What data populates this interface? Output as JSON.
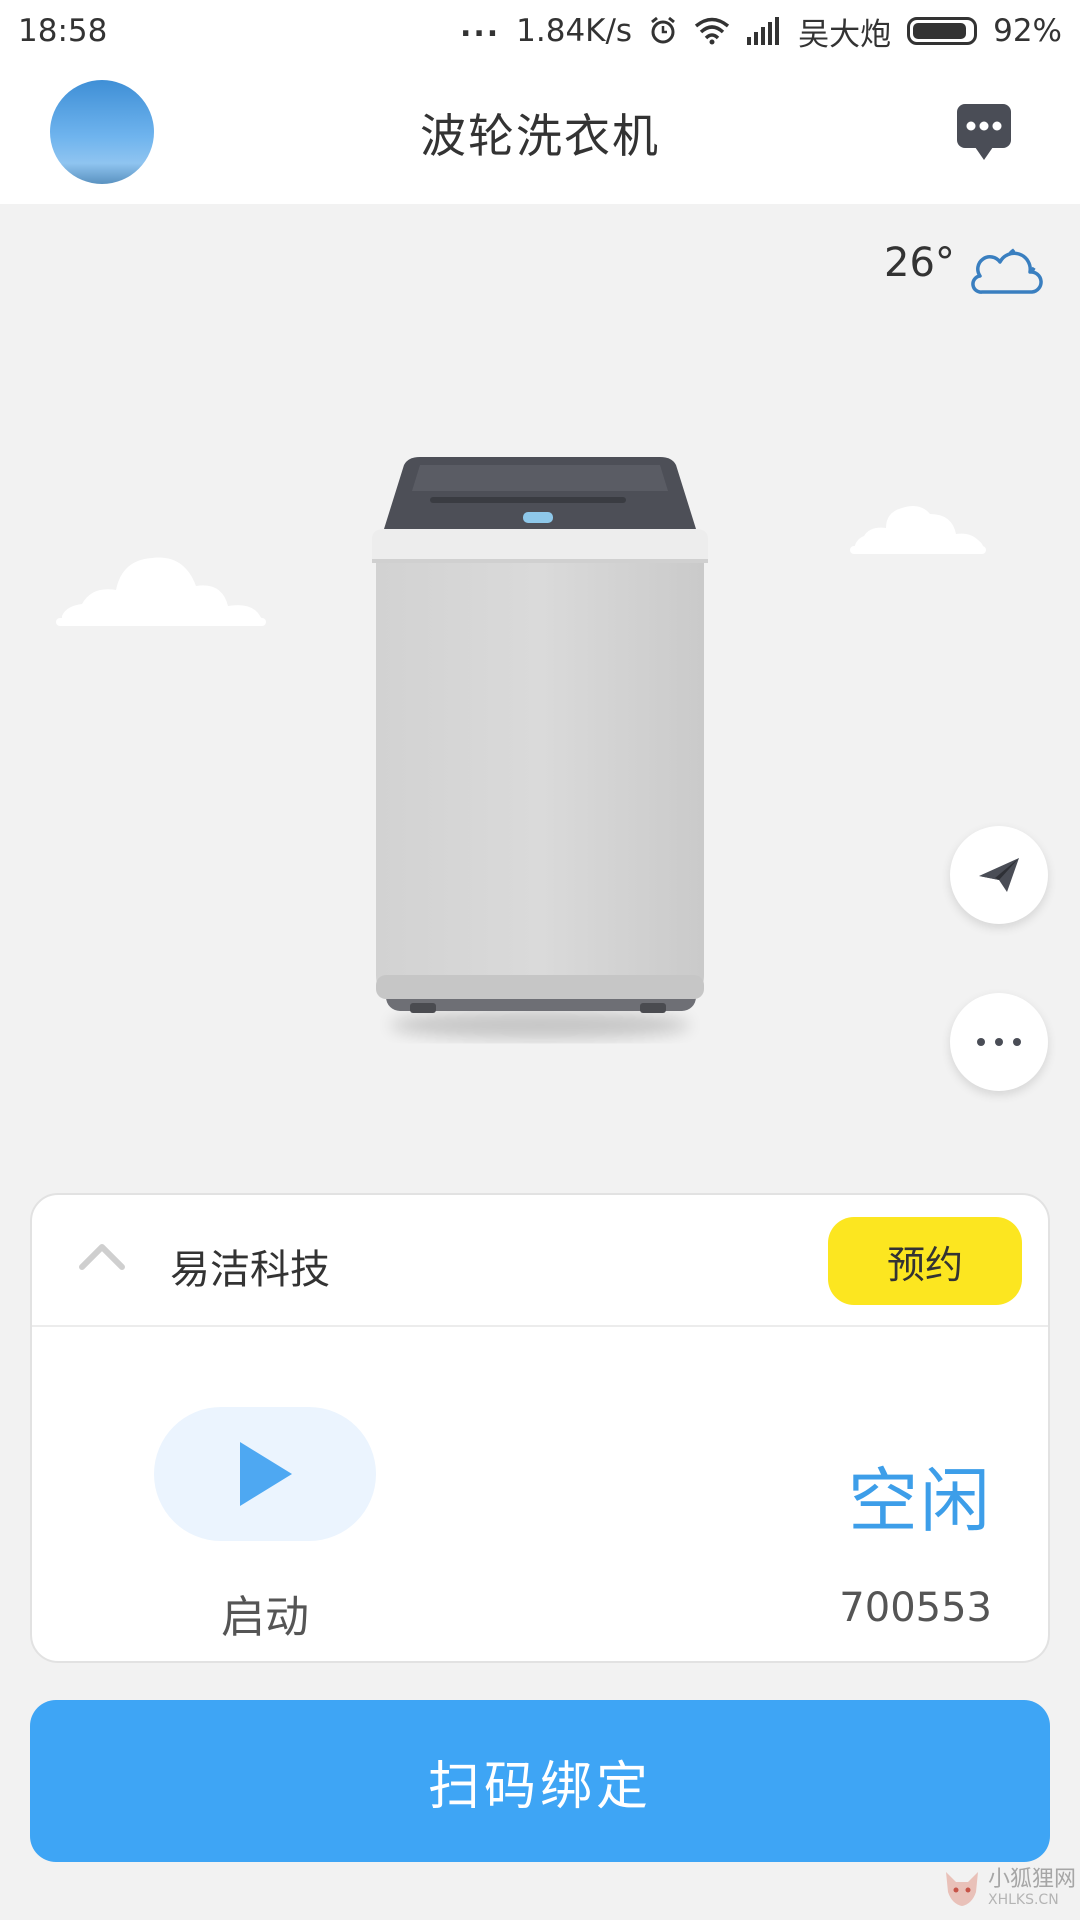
{
  "status_bar": {
    "time": "18:58",
    "more": "...",
    "speed": "1.84K/s",
    "carrier": "吴大炮",
    "battery": "92%",
    "battery_level": 0.92
  },
  "header": {
    "title": "波轮洗衣机",
    "avatar_icon": "avatar-sky",
    "message_icon": "message-bubble-icon"
  },
  "weather": {
    "temperature": "26°",
    "icon": "cloudy-night-icon"
  },
  "actions": {
    "send_icon": "paper-plane-icon",
    "more_icon": "more-dots-icon"
  },
  "device_card": {
    "brand": "易洁科技",
    "reserve_label": "预约",
    "start_label": "启动",
    "status": "空闲",
    "device_id": "700553"
  },
  "bind_button": {
    "label": "扫码绑定"
  },
  "watermark": {
    "text_cn": "小狐狸网",
    "text_en": "XHLKS.CN"
  },
  "colors": {
    "accent_blue": "#3ea5f5",
    "status_blue": "#3d9ee9",
    "reserve_yellow": "#fce620",
    "background": "#f2f2f2"
  }
}
